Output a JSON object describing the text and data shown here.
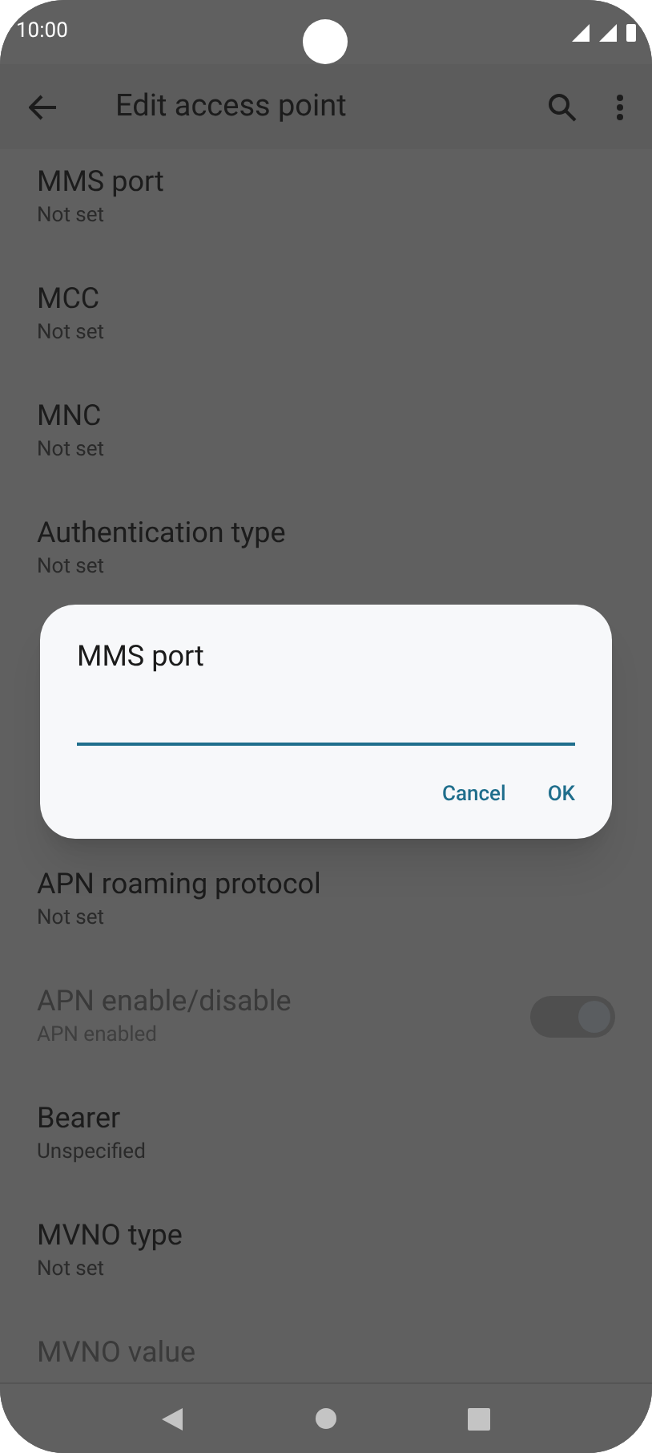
{
  "status_bar": {
    "time": "10:00"
  },
  "app_bar": {
    "title": "Edit access point"
  },
  "settings_top": [
    {
      "kind": "text",
      "title": "MMS port",
      "summary": "Not set",
      "disabled": false
    },
    {
      "kind": "text",
      "title": "MCC",
      "summary": "Not set",
      "disabled": false
    },
    {
      "kind": "text",
      "title": "MNC",
      "summary": "Not set",
      "disabled": false
    },
    {
      "kind": "text",
      "title": "Authentication type",
      "summary": "Not set",
      "disabled": false
    }
  ],
  "settings_bottom": [
    {
      "kind": "text",
      "title": "APN roaming protocol",
      "summary": "Not set",
      "disabled": false
    },
    {
      "kind": "switch",
      "title": "APN enable/disable",
      "summary": "APN enabled",
      "disabled": true,
      "on": true
    },
    {
      "kind": "text",
      "title": "Bearer",
      "summary": "Unspecified",
      "disabled": false
    },
    {
      "kind": "text",
      "title": "MVNO type",
      "summary": "Not set",
      "disabled": false
    },
    {
      "kind": "text",
      "title": "MVNO value",
      "disabled": true
    }
  ],
  "dialog": {
    "title": "MMS port",
    "buttons": [
      "Cancel",
      "OK"
    ]
  }
}
